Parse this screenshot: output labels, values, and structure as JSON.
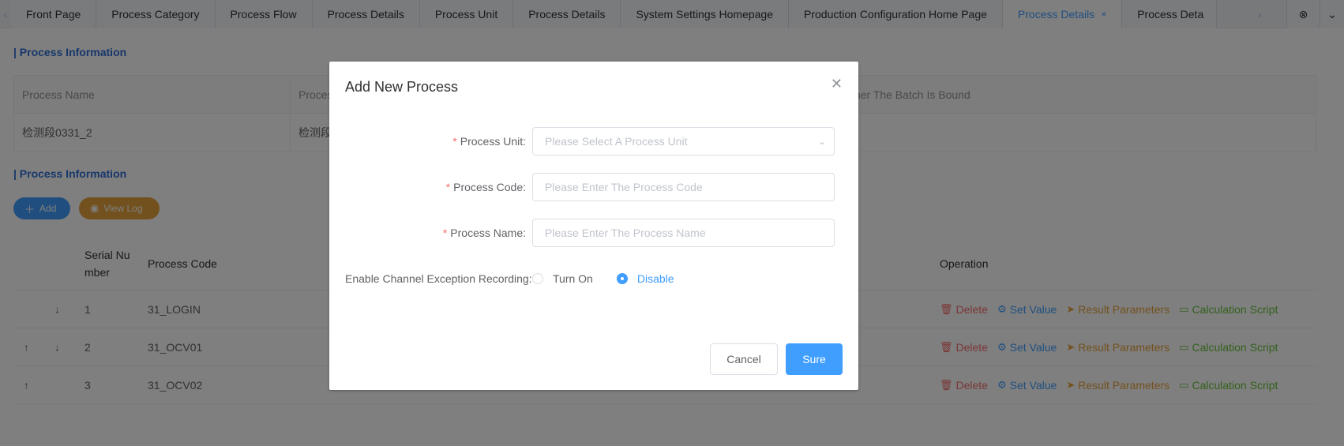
{
  "tabs": [
    {
      "label": "Front Page"
    },
    {
      "label": "Process Category"
    },
    {
      "label": "Process Flow"
    },
    {
      "label": "Process Details"
    },
    {
      "label": "Process Unit"
    },
    {
      "label": "Process Details"
    },
    {
      "label": "System Settings Homepage"
    },
    {
      "label": "Production Configuration Home Page"
    },
    {
      "label": "Process Details",
      "active": true
    },
    {
      "label": "Process Deta"
    }
  ],
  "tab_close_glyph": "×",
  "section1": {
    "title": "| Process Information"
  },
  "info": {
    "headers": [
      "Process Name",
      "Proces",
      "",
      "ther The Batch Is Bound"
    ],
    "values": [
      "检测段0331_2",
      "检测段",
      "",
      ""
    ]
  },
  "section2": {
    "title": "| Process Information"
  },
  "buttons": {
    "add": "Add",
    "view_log": "View Log"
  },
  "list": {
    "headers": {
      "serial": "Serial Number",
      "code": "Process Code",
      "operation": "Operation"
    },
    "rows": [
      {
        "serial": "1",
        "code": "31_LOGIN",
        "up": false,
        "down": true
      },
      {
        "serial": "2",
        "code": "31_OCV01",
        "up": true,
        "down": true
      },
      {
        "serial": "3",
        "code": "31_OCV02",
        "up": true,
        "down": false
      }
    ],
    "ops": {
      "delete": "Delete",
      "set_value": "Set Value",
      "result_params": "Result Parameters",
      "calc_script": "Calculation Script"
    }
  },
  "dialog": {
    "title": "Add New Process",
    "fields": {
      "unit_label": "Process Unit:",
      "unit_placeholder": "Please Select A Process Unit",
      "code_label": "Process Code:",
      "code_placeholder": "Please Enter The Process Code",
      "name_label": "Process Name:",
      "name_placeholder": "Please Enter The Process Name",
      "exception_label": "Enable Channel Exception Recording:",
      "opt_on": "Turn On",
      "opt_off": "Disable",
      "selected": "Disable"
    },
    "cancel": "Cancel",
    "ok": "Sure"
  },
  "colors": {
    "primary": "#409eff",
    "danger": "#f56c6c",
    "warning": "#e6a23c",
    "success": "#67c23a"
  }
}
